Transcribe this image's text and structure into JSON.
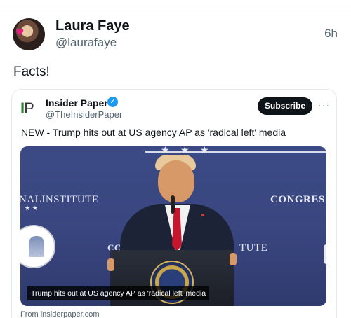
{
  "post": {
    "author_name": "Laura Faye",
    "author_handle": "@laurafaye",
    "time": "6h",
    "text": "Facts!"
  },
  "card": {
    "source_logo": "IP",
    "source_name": "Insider Paper",
    "source_handle": "@TheInsiderPaper",
    "subscribe_label": "Subscribe",
    "more_label": "···",
    "headline": "NEW - Trump hits out at US agency AP as 'radical left' media",
    "media": {
      "bg_text_left": "NALINSTITUTE",
      "bg_text_right": "CONGRES",
      "bg_text_mid_left": "CC",
      "bg_text_mid_right": "TUTE",
      "caption": "Trump hits out at US agency AP as 'radical left' media"
    },
    "from_label": "From insiderpaper.com"
  },
  "icons": {
    "verified": "verified-badge-icon",
    "more": "more-options-icon"
  },
  "colors": {
    "accent": "#1d9bf0",
    "text_secondary": "#536471",
    "subscribe_bg": "#0f1419"
  }
}
